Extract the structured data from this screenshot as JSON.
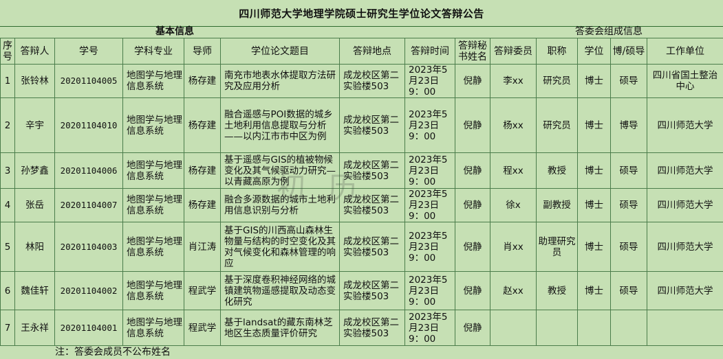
{
  "title": "四川师范大学地理学院硕士研究生学位论文答辩公告",
  "section_basic": "基本信息",
  "section_committee": "答委会组成信息",
  "headers": {
    "seq": "序号",
    "name": "答辩人",
    "id": "学号",
    "major": "学科专业",
    "advisor": "导师",
    "thesis": "学位论文题目",
    "place": "答辩地点",
    "time": "答辩时间",
    "secretary": "答辩秘书姓名",
    "committee_member": "答辩委员",
    "rank": "职称",
    "degree": "学位",
    "supervisor_type": "博/硕导",
    "unit": "工作单位"
  },
  "rows": [
    {
      "seq": "1",
      "name": "张铃林",
      "id": "20201104005",
      "major": "地图学与地理信息系统",
      "advisor": "杨存建",
      "thesis": "南充市地表水体提取方法研究及应用分析",
      "place": "成龙校区第二实验楼503",
      "time": "2023年5月23日9：00",
      "secretary": "倪静",
      "member": "李xx",
      "rank": "研究员",
      "degree": "博士",
      "sup": "硕导",
      "unit": "四川省国土整治中心"
    },
    {
      "seq": "2",
      "name": "辛宇",
      "id": "20201104010",
      "major": "地图学与地理信息系统",
      "advisor": "杨存建",
      "thesis": "融合遥感与POI数据的城乡土地利用信息提取与分析——以内江市市中区为例",
      "place": "成龙校区第二实验楼503",
      "time": "2023年5月23日9：00",
      "secretary": "倪静",
      "member": "杨xx",
      "rank": "研究员",
      "degree": "博士",
      "sup": "博导",
      "unit": "四川师范大学"
    },
    {
      "seq": "3",
      "name": "孙梦鑫",
      "id": "20201104006",
      "major": "地图学与地理信息系统",
      "advisor": "杨存建",
      "thesis": "基于遥感与GIS的植被物候变化及其气候驱动力研究—以青藏高原为例",
      "place": "成龙校区第二实验楼503",
      "time": "2023年5月23日9：00",
      "secretary": "倪静",
      "member": "程xx",
      "rank": "教授",
      "degree": "博士",
      "sup": "硕导",
      "unit": "四川师范大学"
    },
    {
      "seq": "4",
      "name": "张岳",
      "id": "20201104007",
      "major": "地图学与地理信息系统",
      "advisor": "杨存建",
      "thesis": "融合多源数据的城市土地利用信息识别与分析",
      "place": "成龙校区第二实验楼503",
      "time": "2023年5月23日9：00",
      "secretary": "倪静",
      "member": "徐x",
      "rank": "副教授",
      "degree": "博士",
      "sup": "硕导",
      "unit": "四川师范大学"
    },
    {
      "seq": "5",
      "name": "林阳",
      "id": "20201104003",
      "major": "地图学与地理信息系统",
      "advisor": "肖江涛",
      "thesis": "基于GIS的川西高山森林生物量与结构的时空变化及其对气候变化和森林管理的响应",
      "place": "成龙校区第二实验楼503",
      "time": "2023年5月23日9：00",
      "secretary": "倪静",
      "member": "肖xx",
      "rank": "助理研究员",
      "degree": "博士",
      "sup": "硕导",
      "unit": "四川师范大学"
    },
    {
      "seq": "6",
      "name": "魏佳轩",
      "id": "20201104002",
      "major": "地图学与地理信息系统",
      "advisor": "程武学",
      "thesis": "基于深度卷积神经网络的城镇建筑物遥感提取及动态变化研究",
      "place": "成龙校区第二实验楼503",
      "time": "2023年5月23日9：00",
      "secretary": "倪静",
      "member": "赵xx",
      "rank": "教授",
      "degree": "博士",
      "sup": "硕导",
      "unit": "四川师范大学"
    },
    {
      "seq": "7",
      "name": "王永祥",
      "id": "20201104001",
      "major": "地图学与地理信息系统",
      "advisor": "程武学",
      "thesis": "基于landsat的藏东南林芝地区生态质量评价研究",
      "place": "成龙校区第二实验楼503",
      "time": "2023年5月23日9：00",
      "secretary": "倪静",
      "member": "",
      "rank": "",
      "degree": "",
      "sup": "",
      "unit": ""
    }
  ],
  "note": "注：答委会成员不公布姓名",
  "watermark": "初  历",
  "colors": {
    "background": "#c6e0b4",
    "grid": "#4a7c4a"
  }
}
